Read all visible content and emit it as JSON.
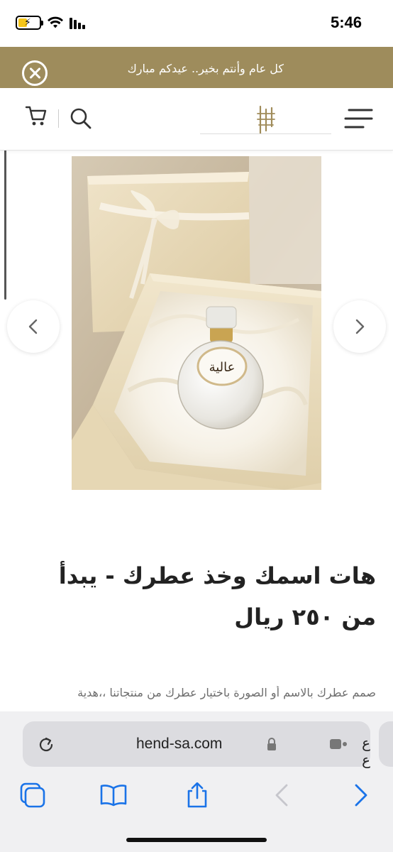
{
  "status_bar": {
    "time": "5:46",
    "icons": [
      "battery-charging-icon",
      "wifi-icon",
      "signal-icon"
    ]
  },
  "promo_banner": {
    "text": "كل عام وأنتم بخير.. عيدكم مبارك",
    "background_color": "#9e8c5c",
    "close_icon": "close-circle-icon"
  },
  "header": {
    "icons": [
      "cart-icon",
      "search-icon",
      "brand-logo-icon",
      "hamburger-menu-icon"
    ]
  },
  "product": {
    "title": "هات اسمك وخذ عطرك - يبدأ من ٢٥٠ ريال",
    "description": "صمم عطرك بالاسم أو الصورة باختيار عطرك من منتجاتنا ،،هدية",
    "image_alt": "perfume-gift-box",
    "bottle_label": "عالية"
  },
  "carousel": {
    "prev_icon": "chevron-left-icon",
    "next_icon": "chevron-right-icon"
  },
  "browser": {
    "url": "hend-sa.com",
    "reader_label": "ع ع",
    "accent_color": "#1a73e8",
    "toolbar": [
      "tabs-icon",
      "bookmarks-icon",
      "share-icon",
      "back-icon",
      "forward-icon"
    ]
  }
}
